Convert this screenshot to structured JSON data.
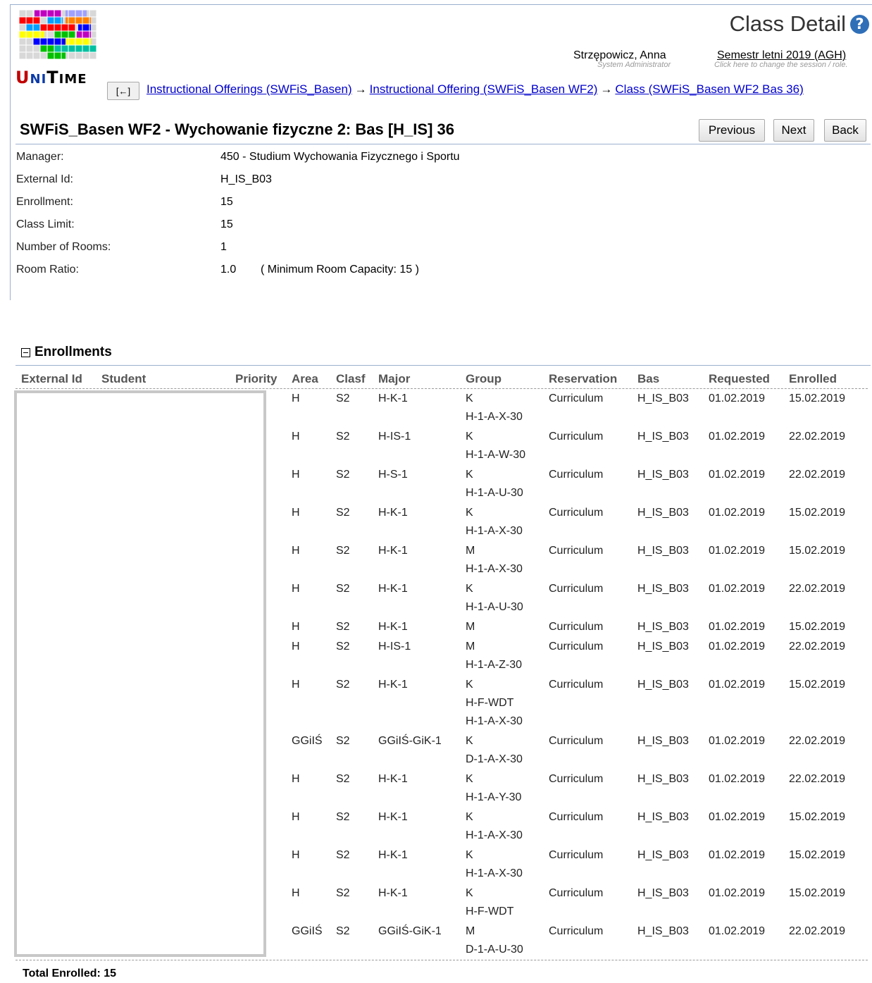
{
  "app": {
    "logo_letters": [
      "U",
      "NI",
      "T",
      "IME"
    ],
    "logo_colors": [
      "#d8d8d8",
      "#c000c0",
      "#ff0000",
      "#00a0ff",
      "#ffff00",
      "#00c000",
      "#0000ff",
      "#00c0a0",
      "#ff8000",
      "#a0a0ff"
    ],
    "page_title": "Class Detail",
    "help_icon": "?",
    "user_name": "Strzępowicz, Anna",
    "user_role": "System Administrator",
    "session_name": "Semestr letni 2019 (AGH)",
    "session_hint": "Click here to change the session / role."
  },
  "nav": {
    "back_small": "[←]",
    "crumbs": [
      "Instructional Offerings (SWFiS_Basen)",
      "Instructional Offering (SWFiS_Basen WF2)",
      "Class (SWFiS_Basen WF2 Bas 36)"
    ],
    "arrow": "→"
  },
  "class": {
    "title": "SWFiS_Basen WF2 - Wychowanie fizyczne 2: Bas [H_IS] 36",
    "buttons": {
      "previous": "Previous",
      "next": "Next",
      "back": "Back"
    },
    "properties": [
      {
        "label": "Manager:",
        "value": "450 - Studium Wychowania Fizycznego i Sportu",
        "note": ""
      },
      {
        "label": "External Id:",
        "value": "H_IS_B03",
        "note": ""
      },
      {
        "label": "Enrollment:",
        "value": "15",
        "note": ""
      },
      {
        "label": "Class Limit:",
        "value": "15",
        "note": ""
      },
      {
        "label": "Number of Rooms:",
        "value": "1",
        "note": ""
      },
      {
        "label": "Room Ratio:",
        "value": "1.0",
        "note": "( Minimum Room Capacity: 15 )"
      }
    ]
  },
  "enrollments": {
    "title": "Enrollments",
    "columns": [
      "External Id",
      "Student",
      "Priority",
      "Area",
      "Clasf",
      "Major",
      "Group",
      "Reservation",
      "Bas",
      "Requested",
      "Enrolled"
    ],
    "rows": [
      {
        "area": "H",
        "clasf": "S2",
        "major": "H-K-1",
        "group": [
          "K",
          "H-1-A-X-30"
        ],
        "reservation": "Curriculum",
        "bas": "H_IS_B03",
        "requested": "01.02.2019",
        "enrolled": "15.02.2019"
      },
      {
        "area": "H",
        "clasf": "S2",
        "major": "H-IS-1",
        "group": [
          "K",
          "H-1-A-W-30"
        ],
        "reservation": "Curriculum",
        "bas": "H_IS_B03",
        "requested": "01.02.2019",
        "enrolled": "22.02.2019"
      },
      {
        "area": "H",
        "clasf": "S2",
        "major": "H-S-1",
        "group": [
          "K",
          "H-1-A-U-30"
        ],
        "reservation": "Curriculum",
        "bas": "H_IS_B03",
        "requested": "01.02.2019",
        "enrolled": "22.02.2019"
      },
      {
        "area": "H",
        "clasf": "S2",
        "major": "H-K-1",
        "group": [
          "K",
          "H-1-A-X-30"
        ],
        "reservation": "Curriculum",
        "bas": "H_IS_B03",
        "requested": "01.02.2019",
        "enrolled": "15.02.2019"
      },
      {
        "area": "H",
        "clasf": "S2",
        "major": "H-K-1",
        "group": [
          "M",
          "H-1-A-X-30"
        ],
        "reservation": "Curriculum",
        "bas": "H_IS_B03",
        "requested": "01.02.2019",
        "enrolled": "15.02.2019"
      },
      {
        "area": "H",
        "clasf": "S2",
        "major": "H-K-1",
        "group": [
          "K",
          "H-1-A-U-30"
        ],
        "reservation": "Curriculum",
        "bas": "H_IS_B03",
        "requested": "01.02.2019",
        "enrolled": "22.02.2019"
      },
      {
        "area": "H",
        "clasf": "S2",
        "major": "H-K-1",
        "group": [
          "M"
        ],
        "reservation": "Curriculum",
        "bas": "H_IS_B03",
        "requested": "01.02.2019",
        "enrolled": "15.02.2019"
      },
      {
        "area": "H",
        "clasf": "S2",
        "major": "H-IS-1",
        "group": [
          "M",
          "H-1-A-Z-30"
        ],
        "reservation": "Curriculum",
        "bas": "H_IS_B03",
        "requested": "01.02.2019",
        "enrolled": "22.02.2019"
      },
      {
        "area": "H",
        "clasf": "S2",
        "major": "H-K-1",
        "group": [
          "K",
          "H-F-WDT",
          "H-1-A-X-30"
        ],
        "reservation": "Curriculum",
        "bas": "H_IS_B03",
        "requested": "01.02.2019",
        "enrolled": "15.02.2019"
      },
      {
        "area": "GGiIŚ",
        "clasf": "S2",
        "major": "GGiIŚ-GiK-1",
        "group": [
          "K",
          "D-1-A-X-30"
        ],
        "reservation": "Curriculum",
        "bas": "H_IS_B03",
        "requested": "01.02.2019",
        "enrolled": "22.02.2019"
      },
      {
        "area": "H",
        "clasf": "S2",
        "major": "H-K-1",
        "group": [
          "K",
          "H-1-A-Y-30"
        ],
        "reservation": "Curriculum",
        "bas": "H_IS_B03",
        "requested": "01.02.2019",
        "enrolled": "22.02.2019"
      },
      {
        "area": "H",
        "clasf": "S2",
        "major": "H-K-1",
        "group": [
          "K",
          "H-1-A-X-30"
        ],
        "reservation": "Curriculum",
        "bas": "H_IS_B03",
        "requested": "01.02.2019",
        "enrolled": "15.02.2019"
      },
      {
        "area": "H",
        "clasf": "S2",
        "major": "H-K-1",
        "group": [
          "K",
          "H-1-A-X-30"
        ],
        "reservation": "Curriculum",
        "bas": "H_IS_B03",
        "requested": "01.02.2019",
        "enrolled": "15.02.2019"
      },
      {
        "area": "H",
        "clasf": "S2",
        "major": "H-K-1",
        "group": [
          "K",
          "H-F-WDT"
        ],
        "reservation": "Curriculum",
        "bas": "H_IS_B03",
        "requested": "01.02.2019",
        "enrolled": "15.02.2019"
      },
      {
        "area": "GGiIŚ",
        "clasf": "S2",
        "major": "GGiIŚ-GiK-1",
        "group": [
          "M",
          "D-1-A-U-30"
        ],
        "reservation": "Curriculum",
        "bas": "H_IS_B03",
        "requested": "01.02.2019",
        "enrolled": "22.02.2019"
      }
    ],
    "total_label": "Total Enrolled: 15"
  }
}
